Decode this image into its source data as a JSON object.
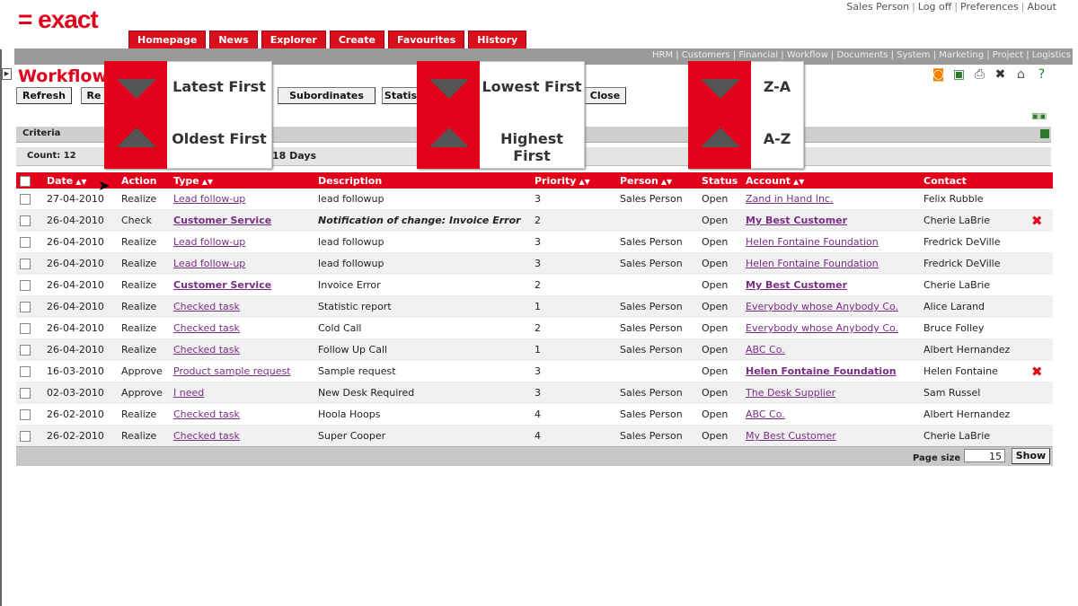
{
  "logo": "= exact",
  "top_links": [
    "Sales Person",
    "Log off",
    "Preferences",
    "About"
  ],
  "nav_tabs": [
    "Homepage",
    "News",
    "Explorer",
    "Create",
    "Favourites",
    "History"
  ],
  "module_links": "HRM | Customers | Financial | Workflow | Documents | System | Marketing | Project | Logistics",
  "page_title": "Workflow",
  "buttons": {
    "refresh": "Refresh",
    "re": "Re",
    "subordinates": "Subordinates",
    "statis": "Statis",
    "close": "Close"
  },
  "criteria_label": "Criteria",
  "count_label": "Count: 12",
  "days_label": "18 Days",
  "columns": [
    "Date",
    "Action",
    "Type",
    "Description",
    "Priority",
    "Person",
    "Status",
    "Account",
    "Contact"
  ],
  "rows": [
    {
      "date": "27-04-2010",
      "action": "Realize",
      "type": "Lead follow-up",
      "type_bold": false,
      "desc": "lead followup",
      "desc_style": "normal",
      "priority": "3",
      "person": "Sales Person",
      "status": "Open",
      "account": "Zand in Hand Inc.",
      "account_bold": false,
      "contact": "Felix Rubble",
      "delete": false
    },
    {
      "date": "26-04-2010",
      "action": "Check",
      "type": "Customer Service",
      "type_bold": true,
      "desc": "Notification of change: Invoice Error",
      "desc_style": "bold-italic",
      "priority": "2",
      "person": "",
      "status": "Open",
      "account": "My Best Customer",
      "account_bold": true,
      "contact": "Cherie LaBrie",
      "delete": true
    },
    {
      "date": "26-04-2010",
      "action": "Realize",
      "type": "Lead follow-up",
      "type_bold": false,
      "desc": "lead followup",
      "desc_style": "normal",
      "priority": "3",
      "person": "Sales Person",
      "status": "Open",
      "account": "Helen Fontaine Foundation",
      "account_bold": false,
      "contact": "Fredrick DeVille",
      "delete": false
    },
    {
      "date": "26-04-2010",
      "action": "Realize",
      "type": "Lead follow-up",
      "type_bold": false,
      "desc": "lead followup",
      "desc_style": "normal",
      "priority": "3",
      "person": "Sales Person",
      "status": "Open",
      "account": "Helen Fontaine Foundation",
      "account_bold": false,
      "contact": "Fredrick DeVille",
      "delete": false
    },
    {
      "date": "26-04-2010",
      "action": "Realize",
      "type": "Customer Service",
      "type_bold": true,
      "desc": "Invoice Error",
      "desc_style": "normal",
      "priority": "2",
      "person": "",
      "status": "Open",
      "account": "My Best Customer",
      "account_bold": true,
      "contact": "Cherie LaBrie",
      "delete": false
    },
    {
      "date": "26-04-2010",
      "action": "Realize",
      "type": "Checked task",
      "type_bold": false,
      "desc": "Statistic report",
      "desc_style": "normal",
      "priority": "1",
      "person": "Sales Person",
      "status": "Open",
      "account": "Everybody whose Anybody Co.",
      "account_bold": false,
      "contact": "Alice Larand",
      "delete": false
    },
    {
      "date": "26-04-2010",
      "action": "Realize",
      "type": "Checked task",
      "type_bold": false,
      "desc": "Cold Call",
      "desc_style": "normal",
      "priority": "2",
      "person": "Sales Person",
      "status": "Open",
      "account": "Everybody whose Anybody Co.",
      "account_bold": false,
      "contact": "Bruce Folley",
      "delete": false
    },
    {
      "date": "26-04-2010",
      "action": "Realize",
      "type": "Checked task",
      "type_bold": false,
      "desc": "Follow Up Call",
      "desc_style": "normal",
      "priority": "1",
      "person": "Sales Person",
      "status": "Open",
      "account": "ABC Co.",
      "account_bold": false,
      "contact": "Albert Hernandez",
      "delete": false
    },
    {
      "date": "16-03-2010",
      "action": "Approve",
      "type": "Product sample request",
      "type_bold": false,
      "desc": "Sample request",
      "desc_style": "normal",
      "priority": "3",
      "person": "",
      "status": "Open",
      "account": "Helen Fontaine Foundation",
      "account_bold": true,
      "contact": "Helen Fontaine",
      "delete": true
    },
    {
      "date": "02-03-2010",
      "action": "Approve",
      "type": "I need",
      "type_bold": false,
      "desc": "New Desk Required",
      "desc_style": "normal",
      "priority": "3",
      "person": "Sales Person",
      "status": "Open",
      "account": "The Desk Supplier",
      "account_bold": false,
      "contact": "Sam Russel",
      "delete": false
    },
    {
      "date": "26-02-2010",
      "action": "Realize",
      "type": "Checked task",
      "type_bold": false,
      "desc": "Hoola Hoops",
      "desc_style": "normal",
      "priority": "4",
      "person": "Sales Person",
      "status": "Open",
      "account": "ABC Co.",
      "account_bold": false,
      "contact": "Albert Hernandez",
      "delete": false
    },
    {
      "date": "26-02-2010",
      "action": "Realize",
      "type": "Checked task",
      "type_bold": false,
      "desc": "Super Cooper",
      "desc_style": "normal",
      "priority": "4",
      "person": "Sales Person",
      "status": "Open",
      "account": "My Best Customer",
      "account_bold": false,
      "contact": "Cherie LaBrie",
      "delete": false
    }
  ],
  "page_size_label": "Page size",
  "page_size_value": "15",
  "show_label": "Show",
  "sort_popups": {
    "date": {
      "desc": "Latest First",
      "asc": "Oldest First"
    },
    "priority": {
      "desc": "Lowest First",
      "asc": "Highest First"
    },
    "account": {
      "desc": "Z-A",
      "asc": "A-Z"
    }
  },
  "colors": {
    "brand_red": "#e2001a",
    "link_purple": "#7b2c86"
  }
}
